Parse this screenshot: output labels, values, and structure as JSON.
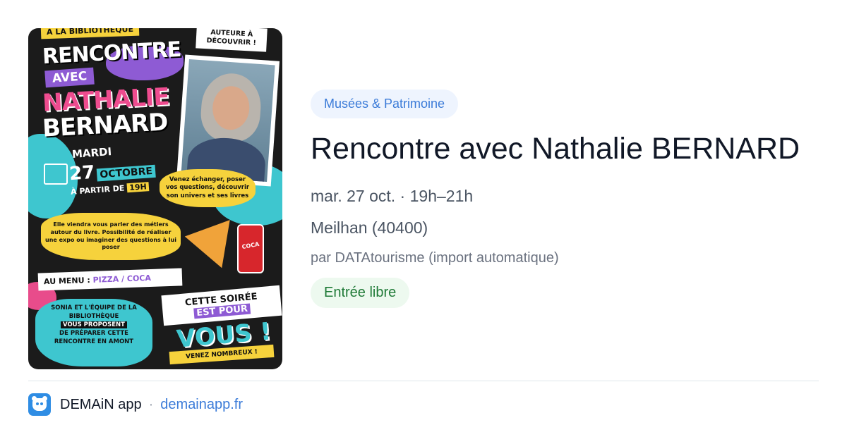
{
  "poster": {
    "top_label": "À LA BIBLIOTHÈQUE",
    "auteure": "AUTEURE À DÉCOUVRIR !",
    "rencontre": "RENCONTRE",
    "avec": "AVEC",
    "nathalie": "NATHALIE",
    "bernard": "BERNARD",
    "mardi": "MARDI",
    "day": "27",
    "month": "OCTOBRE",
    "heure_prefix": "À PARTIR DE",
    "heure": "19H",
    "echanger": "Venez échanger, poser vos questions, découvrir son univers et ses livres",
    "elle": "Elle viendra vous parler des métiers autour du livre. Possibilité de réaliser une expo ou imaginer des questions à lui poser",
    "menu_prefix": "AU MENU :",
    "menu_items": "PIZZA / COCA",
    "sonia_1": "SONIA ET L'ÉQUIPE DE LA BIBLIOTHÈQUE",
    "sonia_tag": "VOUS PROPOSENT",
    "sonia_2": "DE PRÉPARER CETTE RENCONTRE EN AMONT",
    "soiree_1": "CETTE SOIRÉE",
    "soiree_2": "EST POUR",
    "vous": "VOUS !",
    "nombreux": "VENEZ NOMBREUX !",
    "can_label": "COCA"
  },
  "event": {
    "category": "Musées & Patrimoine",
    "title": "Rencontre avec Nathalie BERNARD",
    "when": "mar. 27 oct. · 19h–21h",
    "where": "Meilhan (40400)",
    "source": "par DATAtourisme (import automatique)",
    "price": "Entrée libre"
  },
  "footer": {
    "app_name": "DEMAiN app",
    "separator": "·",
    "url": "demainapp.fr"
  },
  "colors": {
    "accent_blue": "#3b7bd8",
    "badge_bg": "#eef4fe",
    "price_green": "#1f7a37",
    "price_bg": "#edf9ef"
  },
  "icons": {
    "app": "demain-app-icon"
  }
}
